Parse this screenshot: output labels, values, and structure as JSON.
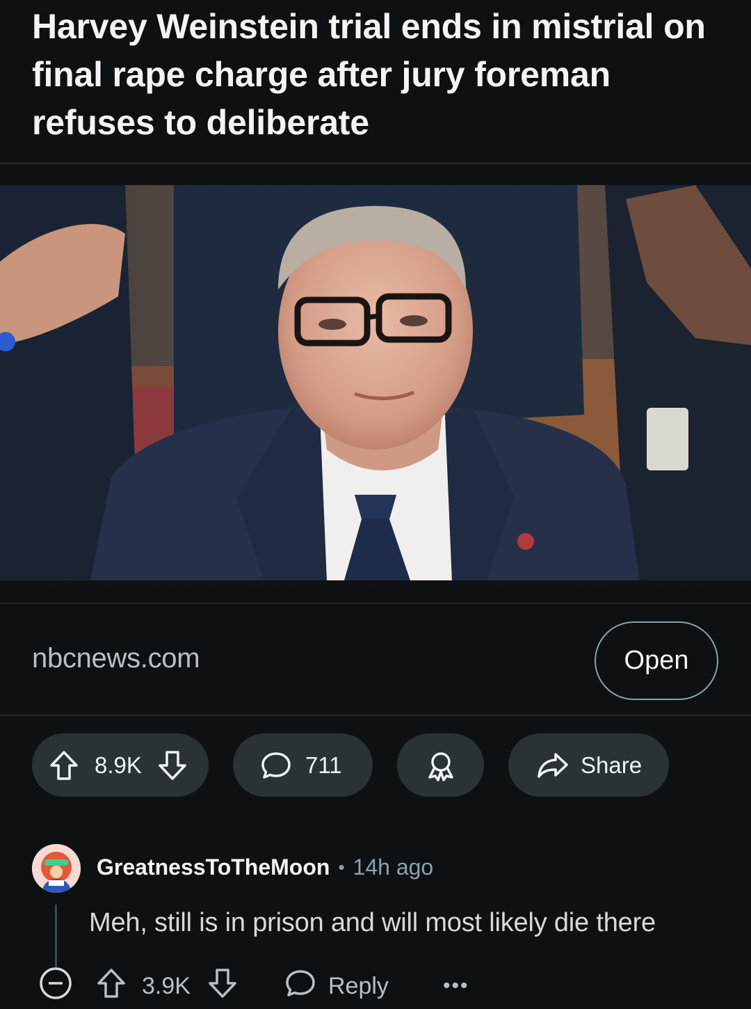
{
  "post": {
    "title": "Harvey Weinstein trial ends in mistrial on final rape charge after jury foreman refuses to deliberate",
    "link_domain": "nbcnews.com",
    "open_label": "Open",
    "image_alt": "Harvey Weinstein in court"
  },
  "actions": {
    "upvotes": "8.9K",
    "comments": "711",
    "share_label": "Share"
  },
  "comment": {
    "username": "GreatnessToTheMoon",
    "separator": "•",
    "time": "14h ago",
    "body": "Meh, still is in prison and will most likely die there",
    "votes": "3.9K",
    "reply_label": "Reply",
    "more_label": "•••"
  },
  "colors": {
    "background": "#0e1113",
    "pill": "#2a3236",
    "muted_text": "#8ba2ad"
  }
}
